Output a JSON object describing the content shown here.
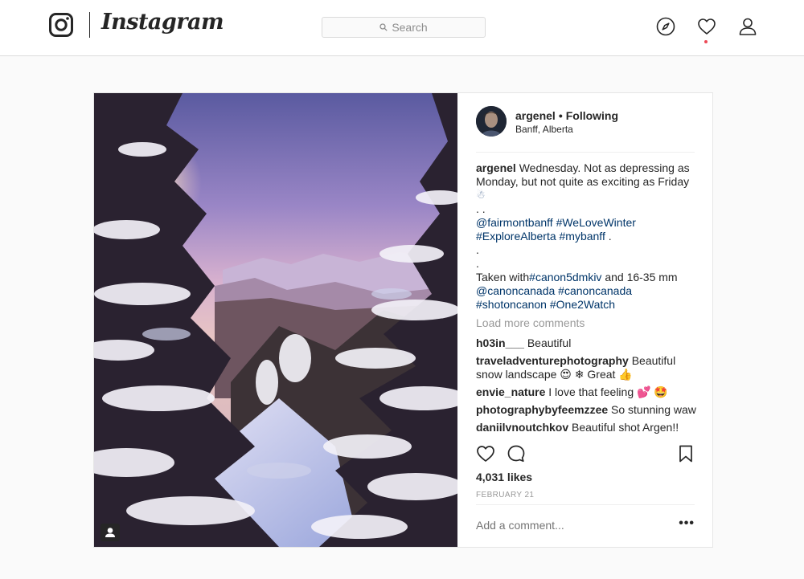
{
  "nav": {
    "brand": "Instagram",
    "search_placeholder": "Search",
    "icons": [
      "instagram-camera-icon",
      "search-icon",
      "compass-icon",
      "heart-icon",
      "profile-icon"
    ]
  },
  "post": {
    "username": "argenel",
    "separator": "•",
    "follow_state": "Following",
    "location": "Banff, Alberta",
    "caption": {
      "text_1": "Wednesday. Not as depressing as",
      "text_2": "Monday, but not quite as exciting as Friday",
      "emoji": "☃",
      "dots": ". .",
      "tags_1a": "@fairmontbanff",
      "tags_1b": "#WeLoveWinter",
      "tags_2": "#ExploreAlberta #mybanff",
      "tags_2_tail": " .",
      "dot_a": ".",
      "dot_b": ".",
      "taken_prefix": "Taken with",
      "taken_tag": "#canon5dmkiv",
      "taken_suffix": " and 16-35 mm",
      "tags_3": "@canoncanada #canoncanada",
      "tags_4": "#shotoncanon #One2Watch"
    },
    "load_more": "Load more comments",
    "comments": [
      {
        "user": "h03in___",
        "text": "Beautiful"
      },
      {
        "user": "traveladventurephotography",
        "text": "Beautiful",
        "text_2": "snow landscape 😍 ❄ Great 👍"
      },
      {
        "user": "envie_nature",
        "text": "I love that feeling 💕 🤩"
      },
      {
        "user": "photographybyfeemzzee",
        "text": "So stunning waw"
      },
      {
        "user": "daniilvnoutchkov",
        "text": "Beautiful shot Argen!!"
      }
    ],
    "likes": "4,031 likes",
    "date": "FEBRUARY 21",
    "comment_placeholder": "Add a comment...",
    "more_options": "•••"
  },
  "colors": {
    "link": "#003569",
    "muted": "#999999",
    "border": "#dbdbdb",
    "notification": "#ed4956"
  }
}
